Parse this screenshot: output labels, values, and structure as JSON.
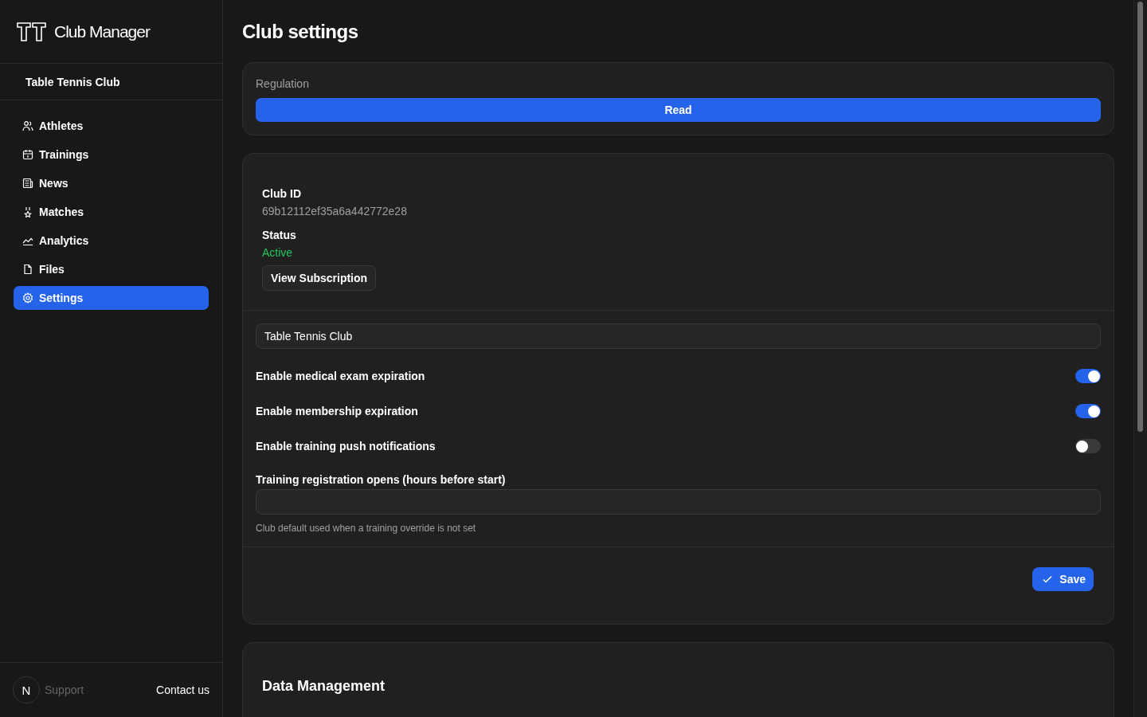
{
  "brand": {
    "name": "Club Manager"
  },
  "club": {
    "name": "Table Tennis Club"
  },
  "nav": [
    {
      "label": "Athletes",
      "kind": "people",
      "selected": false
    },
    {
      "label": "Trainings",
      "kind": "calendar",
      "selected": false
    },
    {
      "label": "News",
      "kind": "newspaper",
      "selected": false
    },
    {
      "label": "Matches",
      "kind": "medal",
      "selected": false
    },
    {
      "label": "Analytics",
      "kind": "chart",
      "selected": false
    },
    {
      "label": "Files",
      "kind": "file",
      "selected": false
    },
    {
      "label": "Settings",
      "kind": "gear",
      "selected": true
    }
  ],
  "footer": {
    "avatar": "N",
    "support": "Support",
    "contact": "Contact us"
  },
  "page_title": "Club settings",
  "regulation": {
    "label": "Regulation",
    "button": "Read"
  },
  "info": [
    {
      "label": "Club ID",
      "value": "69b12112ef35a6a442772e28",
      "kind": "plain"
    },
    {
      "label": "Status",
      "value": "Active",
      "kind": "status"
    }
  ],
  "subscription_button": "View Subscription",
  "club_name_field": {
    "value": "Table Tennis Club"
  },
  "toggles": [
    {
      "label": "Enable medical exam expiration",
      "on": true
    },
    {
      "label": "Enable membership expiration",
      "on": true
    },
    {
      "label": "Enable training push notifications",
      "on": false
    }
  ],
  "hours_field": {
    "label": "Training registration opens (hours before start)",
    "hint": "Club default used when a training override is not set"
  },
  "save_button": "Save",
  "data_management": {
    "title": "Data Management"
  }
}
